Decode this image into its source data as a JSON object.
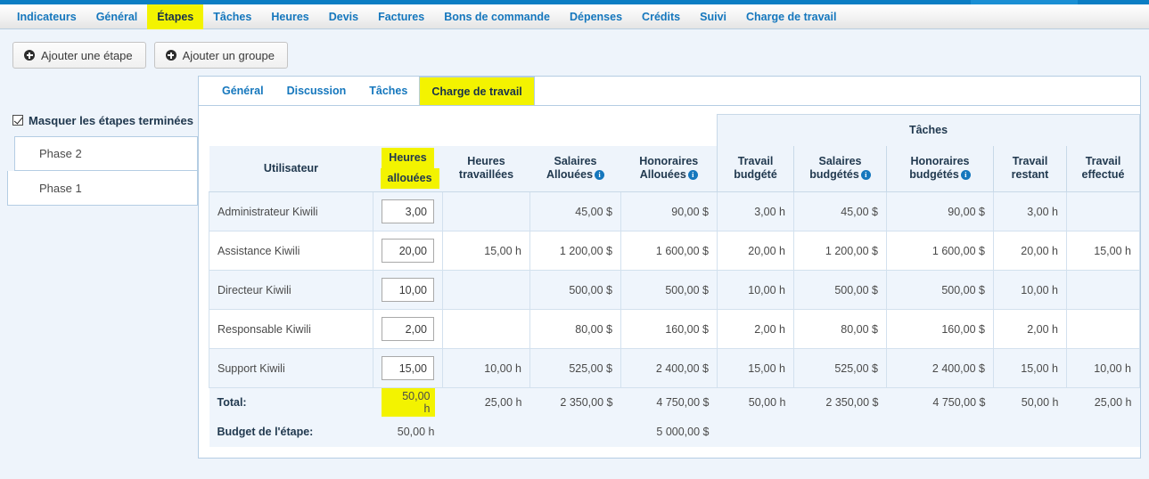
{
  "theme": {
    "accent_blue": "#1577bd",
    "strip_blue": "#0b7ec4",
    "highlight_yellow": "#f3f300",
    "panel_bg": "#eef4fb",
    "row_alt": "#eff5fc"
  },
  "main_nav": {
    "items": [
      {
        "label": "Indicateurs",
        "active": false
      },
      {
        "label": "Général",
        "active": false
      },
      {
        "label": "Étapes",
        "active": true
      },
      {
        "label": "Tâches",
        "active": false
      },
      {
        "label": "Heures",
        "active": false
      },
      {
        "label": "Devis",
        "active": false
      },
      {
        "label": "Factures",
        "active": false
      },
      {
        "label": "Bons de commande",
        "active": false
      },
      {
        "label": "Dépenses",
        "active": false
      },
      {
        "label": "Crédits",
        "active": false
      },
      {
        "label": "Suivi",
        "active": false
      },
      {
        "label": "Charge de travail",
        "active": false
      }
    ]
  },
  "toolbar": {
    "add_step_label": "Ajouter une étape",
    "add_group_label": "Ajouter un groupe",
    "add_icon": "plus-circle-icon"
  },
  "sidebar": {
    "hide_completed_label": "Masquer les étapes terminées",
    "hide_completed_checked": true,
    "phases": [
      {
        "label": "Phase 2",
        "selected": false
      },
      {
        "label": "Phase 1",
        "selected": true
      }
    ]
  },
  "sub_tabs": {
    "items": [
      {
        "label": "Général",
        "active": false
      },
      {
        "label": "Discussion",
        "active": false
      },
      {
        "label": "Tâches",
        "active": false
      },
      {
        "label": "Charge de travail",
        "active": true
      }
    ]
  },
  "table": {
    "group_header": "Tâches",
    "columns": [
      {
        "key": "user",
        "label": "Utilisateur",
        "label2": "",
        "highlight": false,
        "info": false
      },
      {
        "key": "hours_allocated",
        "label": "Heures",
        "label2": "allouées",
        "highlight": true,
        "info": false
      },
      {
        "key": "hours_worked",
        "label": "Heures",
        "label2": "travaillées",
        "highlight": false,
        "info": false
      },
      {
        "key": "salaries_allocated",
        "label": "Salaires",
        "label2": "Allouées",
        "highlight": false,
        "info": true
      },
      {
        "key": "fees_allocated",
        "label": "Honoraires",
        "label2": "Allouées",
        "highlight": false,
        "info": true
      },
      {
        "key": "work_budgeted",
        "label": "Travail",
        "label2": "budgété",
        "highlight": false,
        "info": false
      },
      {
        "key": "salaries_budgeted",
        "label": "Salaires",
        "label2": "budgétés",
        "highlight": false,
        "info": true
      },
      {
        "key": "fees_budgeted",
        "label": "Honoraires",
        "label2": "budgétés",
        "highlight": false,
        "info": true
      },
      {
        "key": "work_remaining",
        "label": "Travail",
        "label2": "restant",
        "highlight": false,
        "info": false
      },
      {
        "key": "work_done",
        "label": "Travail",
        "label2": "effectué",
        "highlight": false,
        "info": false
      }
    ],
    "rows": [
      {
        "user": "Administrateur Kiwili",
        "hours_allocated": "3,00",
        "hours_worked": "",
        "salaries_allocated": "45,00 $",
        "fees_allocated": "90,00 $",
        "work_budgeted": "3,00 h",
        "salaries_budgeted": "45,00 $",
        "fees_budgeted": "90,00 $",
        "work_remaining": "3,00 h",
        "work_done": ""
      },
      {
        "user": "Assistance Kiwili",
        "hours_allocated": "20,00",
        "hours_worked": "15,00 h",
        "salaries_allocated": "1 200,00 $",
        "fees_allocated": "1 600,00 $",
        "work_budgeted": "20,00 h",
        "salaries_budgeted": "1 200,00 $",
        "fees_budgeted": "1 600,00 $",
        "work_remaining": "20,00 h",
        "work_done": "15,00 h"
      },
      {
        "user": "Directeur Kiwili",
        "hours_allocated": "10,00",
        "hours_worked": "",
        "salaries_allocated": "500,00 $",
        "fees_allocated": "500,00 $",
        "work_budgeted": "10,00 h",
        "salaries_budgeted": "500,00 $",
        "fees_budgeted": "500,00 $",
        "work_remaining": "10,00 h",
        "work_done": ""
      },
      {
        "user": "Responsable Kiwili",
        "hours_allocated": "2,00",
        "hours_worked": "",
        "salaries_allocated": "80,00 $",
        "fees_allocated": "160,00 $",
        "work_budgeted": "2,00 h",
        "salaries_budgeted": "80,00 $",
        "fees_budgeted": "160,00 $",
        "work_remaining": "2,00 h",
        "work_done": ""
      },
      {
        "user": "Support Kiwili",
        "hours_allocated": "15,00",
        "hours_worked": "10,00 h",
        "salaries_allocated": "525,00 $",
        "fees_allocated": "2 400,00 $",
        "work_budgeted": "15,00 h",
        "salaries_budgeted": "525,00 $",
        "fees_budgeted": "2 400,00 $",
        "work_remaining": "15,00 h",
        "work_done": "10,00 h"
      }
    ],
    "total_row": {
      "label": "Total:",
      "hours_allocated": "50,00 h",
      "hours_worked": "25,00 h",
      "salaries_allocated": "2 350,00 $",
      "fees_allocated": "4 750,00 $",
      "work_budgeted": "50,00 h",
      "salaries_budgeted": "2 350,00 $",
      "fees_budgeted": "4 750,00 $",
      "work_remaining": "50,00 h",
      "work_done": "25,00 h"
    },
    "budget_row": {
      "label": "Budget de l'étape:",
      "hours_allocated": "50,00 h",
      "hours_worked": "",
      "salaries_allocated": "",
      "fees_allocated": "5 000,00 $",
      "work_budgeted": "",
      "salaries_budgeted": "",
      "fees_budgeted": "",
      "work_remaining": "",
      "work_done": ""
    }
  }
}
